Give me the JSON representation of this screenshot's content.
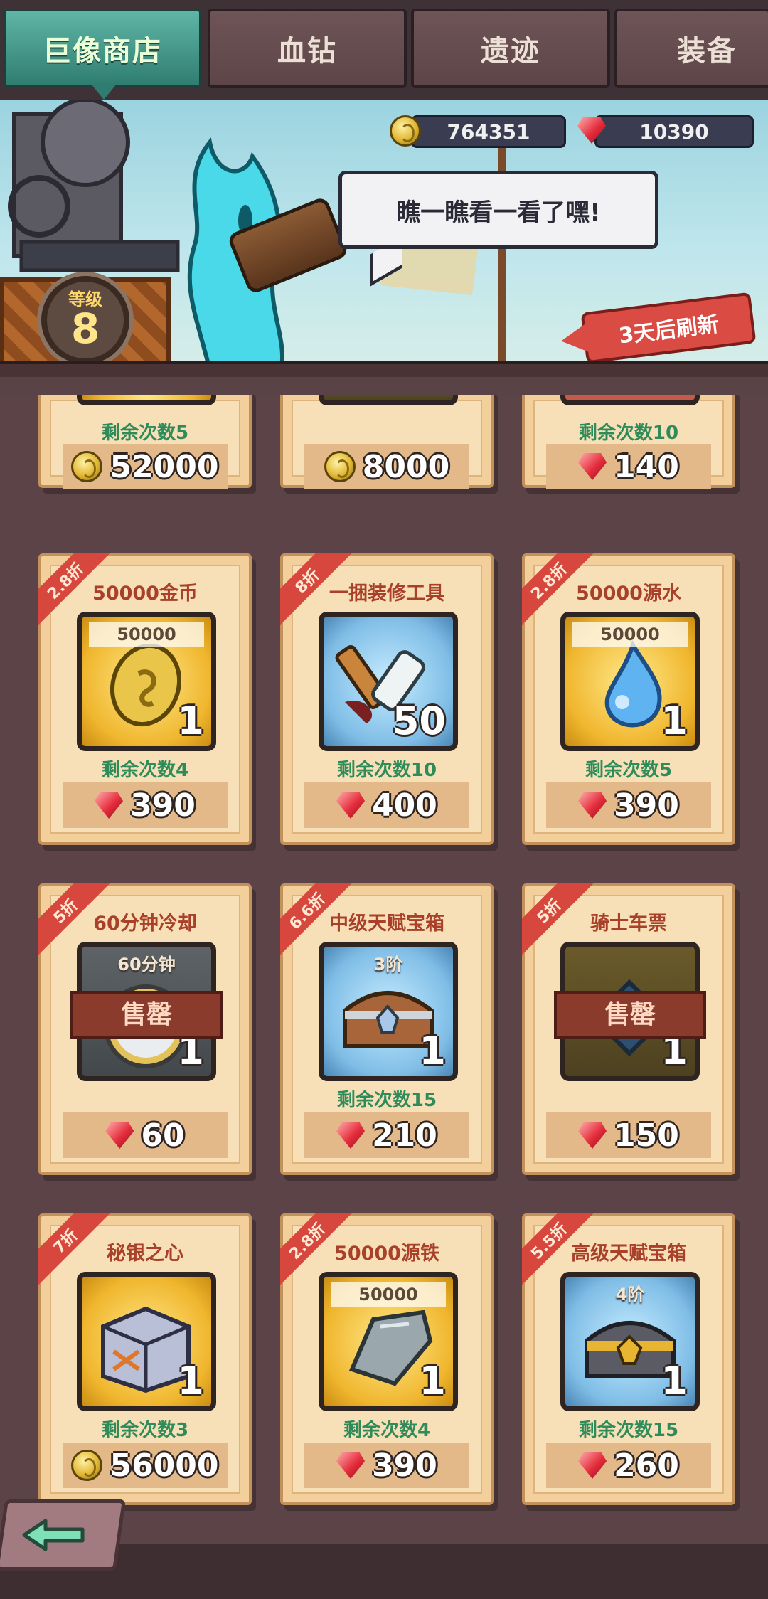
{
  "tabs": [
    {
      "label": "巨像商店",
      "active": true
    },
    {
      "label": "血钻",
      "active": false
    },
    {
      "label": "遗迹",
      "active": false
    },
    {
      "label": "装备",
      "active": false
    }
  ],
  "currencies": {
    "gold": {
      "icon": "gold-coin-icon",
      "value": "764351"
    },
    "gems": {
      "icon": "red-gem-icon",
      "value": "10390"
    }
  },
  "banner": {
    "speech": "瞧一瞧看一看了嘿!",
    "level_label": "等级",
    "level_value": "8",
    "refresh_text": "3天后刷新"
  },
  "partial_row": [
    {
      "remaining": "剩余次数5",
      "currency": "gold",
      "price": "52000"
    },
    {
      "remaining": "",
      "currency": "gold",
      "price": "8000"
    },
    {
      "remaining": "剩余次数10",
      "currency": "gem",
      "price": "140"
    }
  ],
  "items": [
    {
      "discount": "2.8折",
      "title": "50000金币",
      "box": "gold",
      "top_label": "50000",
      "qty": "1",
      "icon": "gold-coin-icon",
      "sold": "",
      "remaining": "剩余次数4",
      "currency": "gem",
      "price": "390"
    },
    {
      "discount": "8折",
      "title": "一捆装修工具",
      "box": "blue",
      "top_label": "",
      "qty": "50",
      "icon": "repair-tools-icon",
      "sold": "",
      "remaining": "剩余次数10",
      "currency": "gem",
      "price": "400"
    },
    {
      "discount": "2.8折",
      "title": "50000源水",
      "box": "gold",
      "top_label": "50000",
      "qty": "1",
      "icon": "water-drop-icon",
      "sold": "",
      "remaining": "剩余次数5",
      "currency": "gem",
      "price": "390"
    },
    {
      "discount": "5折",
      "title": "60分钟冷却",
      "box": "dark",
      "top_label": "60分钟",
      "qty": "1",
      "icon": "stopwatch-icon",
      "sold": "售罄",
      "remaining": "",
      "currency": "gem",
      "price": "60"
    },
    {
      "discount": "6.6折",
      "title": "中级天赋宝箱",
      "box": "blue",
      "top_label": "3阶",
      "qty": "1",
      "icon": "treasure-chest-icon",
      "sold": "",
      "remaining": "剩余次数15",
      "currency": "gem",
      "price": "210"
    },
    {
      "discount": "5折",
      "title": "骑士车票",
      "box": "olive",
      "top_label": "",
      "qty": "1",
      "icon": "knight-ticket-icon",
      "sold": "售罄",
      "remaining": "",
      "currency": "gem",
      "price": "150"
    },
    {
      "discount": "7折",
      "title": "秘银之心",
      "box": "gold",
      "top_label": "",
      "qty": "1",
      "icon": "mithril-crate-icon",
      "sold": "",
      "remaining": "剩余次数3",
      "currency": "gold",
      "price": "56000"
    },
    {
      "discount": "2.8折",
      "title": "50000源铁",
      "box": "gold",
      "top_label": "50000",
      "qty": "1",
      "icon": "iron-ore-icon",
      "sold": "",
      "remaining": "剩余次数4",
      "currency": "gem",
      "price": "390"
    },
    {
      "discount": "5.5折",
      "title": "高级天赋宝箱",
      "box": "blue",
      "top_label": "4阶",
      "qty": "1",
      "icon": "gold-treasure-chest-icon",
      "sold": "",
      "remaining": "剩余次数15",
      "currency": "gem",
      "price": "260"
    }
  ],
  "back_button": {
    "icon": "back-arrow-icon"
  }
}
